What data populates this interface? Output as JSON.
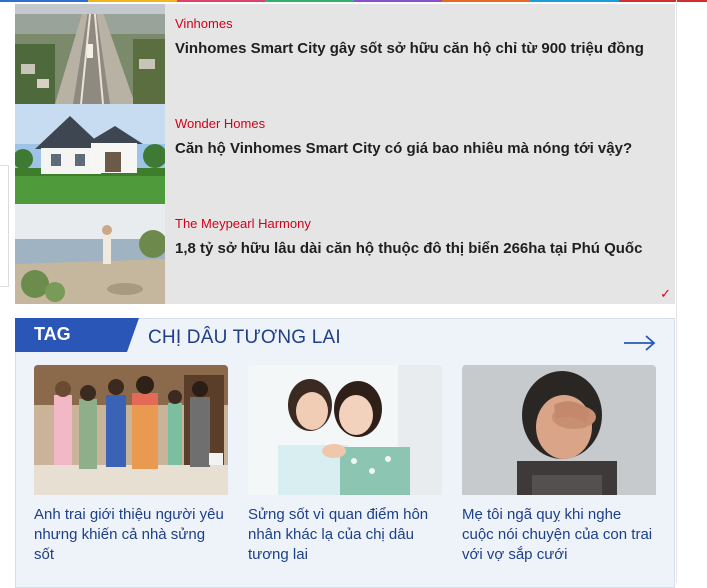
{
  "colors": {
    "topstrip": [
      "#2f6fd1",
      "#f2b51c",
      "#e0406b",
      "#2fb36b",
      "#8a4fcf",
      "#e86a1e",
      "#1c9cd8",
      "#d12f2f"
    ],
    "source_red": "#d0021b",
    "tag_blue": "#1f3f87",
    "tag_label_bg": "#2a56b8"
  },
  "sponsored": {
    "items": [
      {
        "source": "Vinhomes",
        "title": "Vinhomes Smart City gây sốt sở hữu căn hộ chỉ từ 900 triệu đồng",
        "image": "metro-rail-aerial"
      },
      {
        "source": "Wonder Homes",
        "title": "Căn hộ Vinhomes Smart City có giá bao nhiêu mà nóng tới vậy?",
        "image": "white-villa-lawn"
      },
      {
        "source": "The Meypearl Harmony",
        "title": "1,8 tỷ sở hữu lâu dài căn hộ thuộc đô thị biển 266ha tại Phú Quốc",
        "image": "seaside-terrace"
      }
    ],
    "mark": "✓"
  },
  "tag_section": {
    "label": "TAG",
    "name": "CHỊ DÂU TƯƠNG LAI",
    "more_icon": "arrow-right-icon",
    "cards": [
      {
        "title": "Anh trai giới thiệu người yêu nhưng khiến cả nhà sửng sốt",
        "image": "family-drama-scene"
      },
      {
        "title": "Sửng sốt vì quan điểm hôn nhân khác lạ của chị dâu tương lai",
        "image": "two-women-smiling"
      },
      {
        "title": "Mẹ tôi ngã quỵ khi nghe cuộc nói chuyện của con trai với vợ sắp cưới",
        "image": "distressed-woman"
      }
    ]
  }
}
